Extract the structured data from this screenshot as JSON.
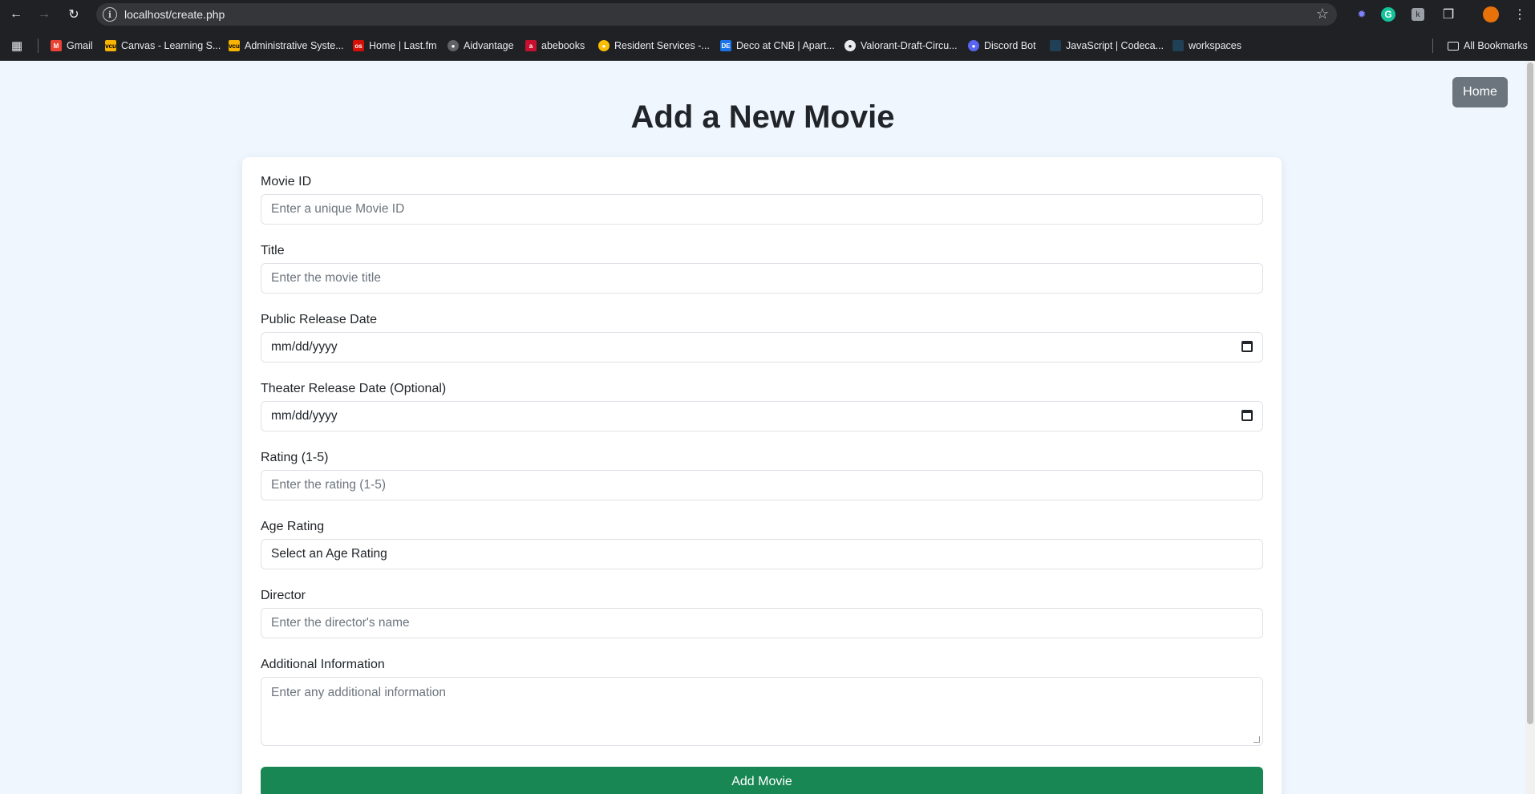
{
  "browser": {
    "url": "localhost/create.php",
    "bookmarks": [
      {
        "label": "Gmail",
        "icon": "gmail-icon",
        "color": "#ea4335"
      },
      {
        "label": "Canvas - Learning S...",
        "icon": "vcu-icon",
        "color": "#f8b400"
      },
      {
        "label": "Administrative Syste...",
        "icon": "vcu-icon",
        "color": "#f8b400"
      },
      {
        "label": "Home | Last.fm",
        "icon": "lastfm-icon",
        "color": "#d51007"
      },
      {
        "label": "Aidvantage",
        "icon": "globe-icon",
        "color": "#9aa0a6"
      },
      {
        "label": "abebooks",
        "icon": "abebooks-icon",
        "color": "#c8102e"
      },
      {
        "label": "Resident Services -...",
        "icon": "chrome-icon",
        "color": "#fbbc04"
      },
      {
        "label": "Deco at CNB | Apart...",
        "icon": "deco-icon",
        "color": "#1a73e8"
      },
      {
        "label": "Valorant-Draft-Circu...",
        "icon": "github-icon",
        "color": "#ffffff"
      },
      {
        "label": "Discord Bot",
        "icon": "discord-icon",
        "color": "#5865f2"
      },
      {
        "label": "JavaScript | Codeca...",
        "icon": "codecademy-icon",
        "color": "#1f4056"
      },
      {
        "label": "workspaces",
        "icon": "workspaces-icon",
        "color": "#1f4056"
      }
    ],
    "all_bookmarks_label": "All Bookmarks"
  },
  "header": {
    "home_label": "Home",
    "title": "Add a New Movie"
  },
  "form": {
    "movie_id": {
      "label": "Movie ID",
      "placeholder": "Enter a unique Movie ID"
    },
    "title": {
      "label": "Title",
      "placeholder": "Enter the movie title"
    },
    "public_release": {
      "label": "Public Release Date",
      "value": "mm/dd/yyyy"
    },
    "theater_release": {
      "label": "Theater Release Date (Optional)",
      "value": "mm/dd/yyyy"
    },
    "rating": {
      "label": "Rating (1-5)",
      "placeholder": "Enter the rating (1-5)"
    },
    "age_rating": {
      "label": "Age Rating",
      "value": "Select an Age Rating"
    },
    "director": {
      "label": "Director",
      "placeholder": "Enter the director's name"
    },
    "additional_info": {
      "label": "Additional Information",
      "placeholder": "Enter any additional information"
    },
    "submit_label": "Add Movie"
  },
  "colors": {
    "page_bg": "#eff6fe",
    "submit_button": "#198754",
    "home_button": "#6c757d"
  }
}
